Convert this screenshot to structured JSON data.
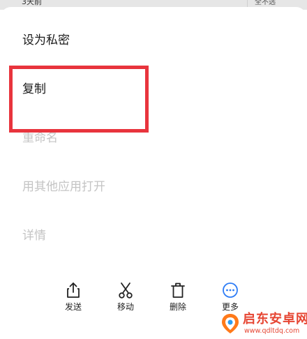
{
  "background_list": {
    "date_text": "3天前",
    "deselect_all_label": "全不选"
  },
  "menu": {
    "items": [
      {
        "label": "设为私密",
        "enabled": true
      },
      {
        "label": "复制",
        "enabled": true
      },
      {
        "label": "重命名",
        "enabled": false
      },
      {
        "label": "用其他应用打开",
        "enabled": false
      },
      {
        "label": "详情",
        "enabled": false
      }
    ]
  },
  "actions": {
    "items": [
      {
        "label": "发送",
        "icon": "share-icon"
      },
      {
        "label": "移动",
        "icon": "scissors-icon"
      },
      {
        "label": "删除",
        "icon": "trash-icon"
      },
      {
        "label": "更多",
        "icon": "more-icon"
      }
    ]
  },
  "annotation": {
    "highlight_color": "#e8343d"
  },
  "watermark": {
    "title": "启东安卓网",
    "url": "www.qdltdq.com",
    "color": "#e64532"
  },
  "colors": {
    "accent_blue": "#2d7cf6",
    "disabled_text": "#c4c4c4",
    "enabled_text": "#1a1a1a"
  }
}
